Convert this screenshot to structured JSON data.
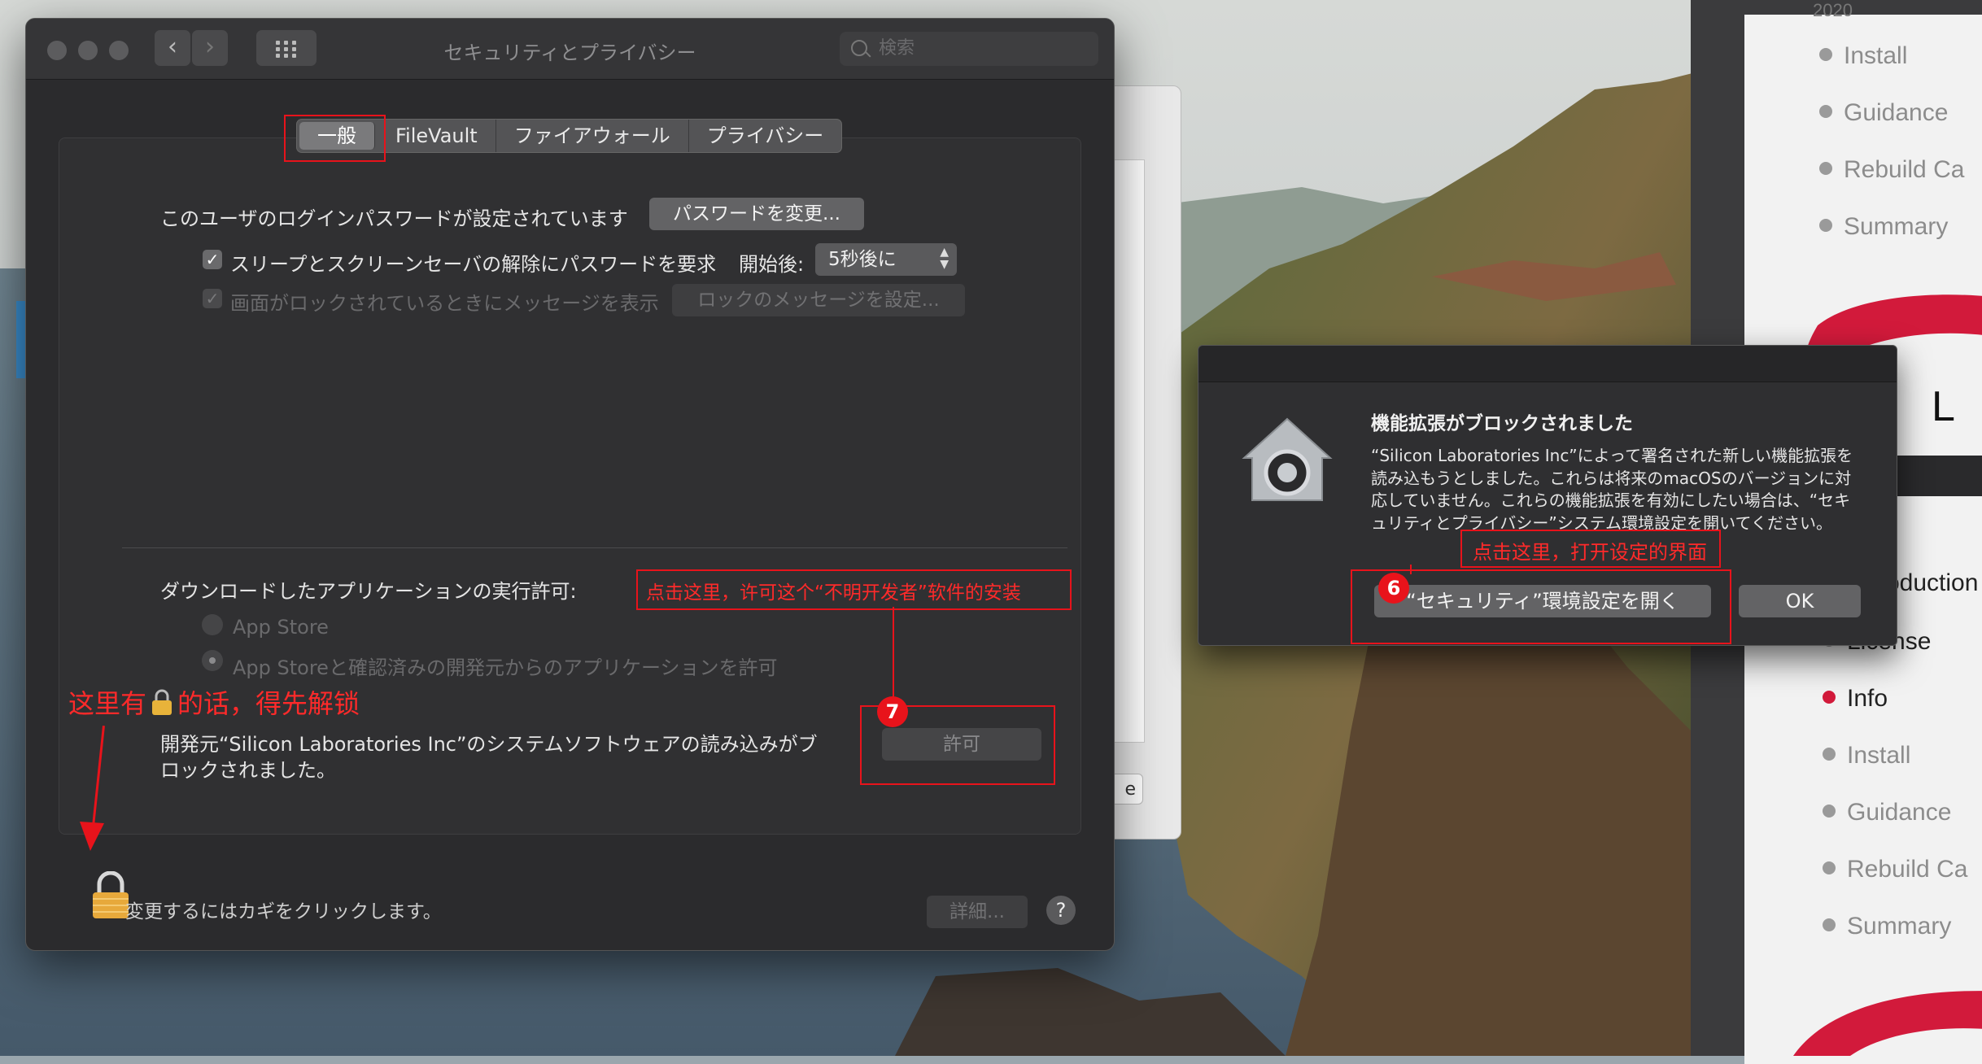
{
  "window": {
    "title": "セキュリティとプライバシー",
    "search_placeholder": "検索",
    "back_glyph": "‹",
    "forward_glyph": "›"
  },
  "tabs": [
    "一般",
    "FileVault",
    "ファイアウォール",
    "プライバシー"
  ],
  "general": {
    "password_set_text": "このユーザのログインパスワードが設定されています",
    "change_password_button": "パスワードを変更...",
    "require_password_label": "スリープとスクリーンセーバの解除にパスワードを要求",
    "require_password_checked": true,
    "after_label": "開始後:",
    "after_value": "5秒後に",
    "lock_message_label": "画面がロックされているときにメッセージを表示",
    "lock_message_checked": true,
    "lock_message_button": "ロックのメッセージを設定...",
    "download_allow_label": "ダウンロードしたアプリケーションの実行許可:",
    "radio_options": [
      "App Store",
      "App Storeと確認済みの開発元からのアプリケーションを許可"
    ],
    "radio_selected": "App Storeと確認済みの開発元からのアプリケーションを許可",
    "blocked_text": "開発元“Silicon Laboratories Inc”のシステムソフトウェアの読み込みがブロックされました。",
    "allow_button": "許可"
  },
  "footer": {
    "lock_text": "変更するにはカギをクリックします。",
    "details_button": "詳細...",
    "help_button": "?"
  },
  "alert": {
    "title": "機能拡張がブロックされました",
    "body": "“Silicon Laboratories Inc”によって署名された新しい機能拡張を読み込もうとしました。これらは将来のmacOSのバージョンに対応していません。これらの機能拡張を有効にしたい場合は、“セキュリティとプライバシー”システム環境設定を開いてください。",
    "open_prefs_button": "“セキュリティ”環境設定を開く",
    "ok_button": "OK"
  },
  "installer_sidebar": {
    "top_items": [
      "Install",
      "Guidance",
      "Rebuild Ca",
      "Summary"
    ],
    "logo_text": "N L",
    "bottom_items": [
      "oduction",
      "License",
      "Info",
      "Install",
      "Guidance",
      "Rebuild Ca",
      "Summary"
    ],
    "active_item": "Info",
    "top_label": "2020"
  },
  "annotations": {
    "step6_badge": "6",
    "step7_badge": "7",
    "note_open_prefs": "点击这里，打开设定的界面",
    "note_allow": "点击这里，许可这个“不明开发者”软件的安装",
    "note_unlock_prefix": "这里有",
    "note_unlock_suffix": "的话，得先解锁"
  },
  "colors": {
    "annotation_red": "#e8131b",
    "installer_active_dot": "#d21a3b",
    "window_bg": "#2b2b2d"
  }
}
